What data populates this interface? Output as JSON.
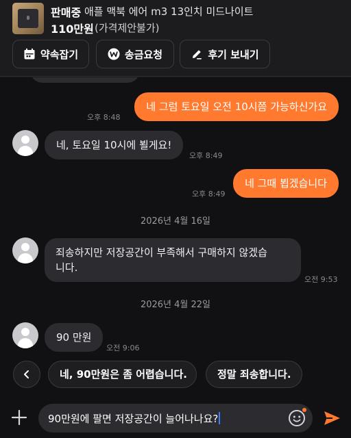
{
  "header": {
    "status": "판매중",
    "title": "애플 맥북 에어 m3 13인치 미드나이트",
    "price": "110만원",
    "price_note": "(가격제안불가)",
    "actions": {
      "schedule": "약속잡기",
      "remit": "송금요청",
      "review": "후기 보내기"
    }
  },
  "messages": [
    {
      "from": "me",
      "text": "네 그럼 토요일 오전 10시쯤 가능하신가요",
      "time": "오후 8:48"
    },
    {
      "from": "other",
      "text": "네, 토요일 10시에 뵐게요!",
      "time": "오후 8:49"
    },
    {
      "from": "me",
      "text": "네 그때 뵙겠습니다",
      "time": "오후 8:49"
    },
    {
      "type": "date",
      "text": "2026년 4월 16일"
    },
    {
      "from": "other",
      "lines": [
        "죄송하지만 저장공간이 부족해서 구매하지 않겠습",
        "니다."
      ],
      "time": "오전 9:53"
    },
    {
      "type": "date",
      "text": "2026년 4월 22일"
    },
    {
      "from": "other",
      "text": "90 만원",
      "time": "오전 9:06"
    }
  ],
  "quick_replies": [
    "네, 90만원은 좀 어렵습니다.",
    "정말 죄송합니다."
  ],
  "composer": {
    "text": "90만원에 팔면 저장공간이 늘어나나요?"
  },
  "colors": {
    "accent": "#ff7a2e",
    "background": "#111113",
    "bubble_other": "#2c2c30",
    "caret": "#3c7dff"
  },
  "icons": {
    "schedule": "calendar-icon",
    "remit": "won-pay-icon",
    "review": "pencil-icon",
    "back": "chevron-left-icon",
    "plus": "plus-icon",
    "emoji": "smiley-icon",
    "send": "send-icon"
  }
}
